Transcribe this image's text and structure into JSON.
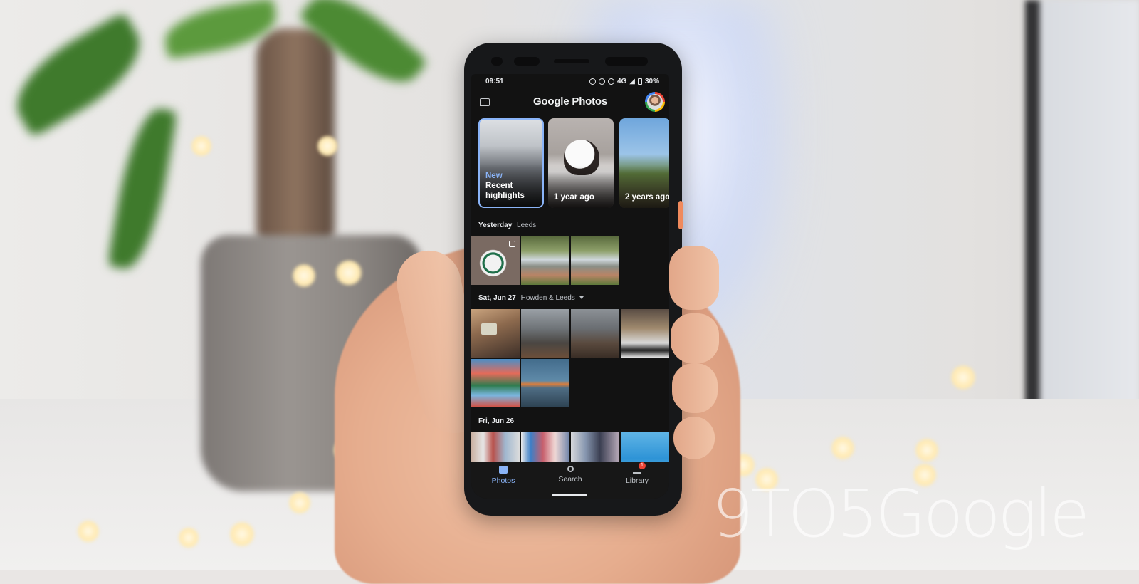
{
  "status_bar": {
    "time": "09:51",
    "battery": "30%",
    "network": "4G",
    "icons": [
      "alarm-icon",
      "mute-icon",
      "dnd-icon",
      "signal-icon",
      "battery-icon"
    ]
  },
  "app_bar": {
    "title": "Google Photos",
    "icons": [
      "messages-icon",
      "account-avatar"
    ]
  },
  "memories": [
    {
      "new_badge": "New",
      "label": "Recent highlights"
    },
    {
      "label": "1 year ago"
    },
    {
      "label": "2 years ago"
    }
  ],
  "sections": [
    {
      "date": "Yesterday",
      "location": "Leeds"
    },
    {
      "date": "Sat, Jun 27",
      "location": "Howden & Leeds"
    },
    {
      "date": "Fri, Jun 26",
      "location": ""
    }
  ],
  "bottom_nav": [
    {
      "label": "Photos",
      "icon": "photos-icon",
      "active": true
    },
    {
      "label": "Search",
      "icon": "search-icon",
      "active": false
    },
    {
      "label": "Library",
      "icon": "library-icon",
      "active": false,
      "badge": "1"
    }
  ],
  "watermark": "9TO5Google",
  "colors": {
    "accent": "#8ab4f8",
    "background": "#121212",
    "badge": "#ea4335"
  }
}
